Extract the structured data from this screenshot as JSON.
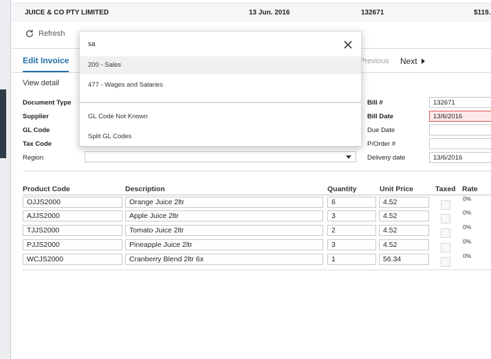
{
  "list": {
    "row": {
      "supplier": "JUICE & CO PTY LIMITED",
      "date": "13 Jun. 2016",
      "bill_number": "132671",
      "amount": "$119."
    }
  },
  "toolbar": {
    "refresh_label": "Refresh"
  },
  "tabs": {
    "active_label": "Edit Invoice",
    "previous_label": "Previous",
    "next_label": "Next"
  },
  "view_detail_label": "View detail",
  "form": {
    "document_type_label": "Document Type",
    "supplier_label": "Supplier",
    "gl_code_label": "GL Code",
    "tax_code_label": "Tax Code",
    "region_label": "Region",
    "bill_number_label": "Bill #",
    "bill_number_value": "132671",
    "bill_date_label": "Bill Date",
    "bill_date_value": "13/6/2016",
    "due_date_label": "Due Date",
    "po_label": "P/Order #",
    "delivery_date_label": "Delivery date",
    "delivery_date_value": "13/6/2016"
  },
  "table": {
    "headers": {
      "product_code": "Product Code",
      "description": "Description",
      "quantity": "Quantity",
      "unit_price": "Unit Price",
      "taxed": "Taxed",
      "rate": "Rate"
    },
    "rows": [
      {
        "code": "OJJS2000",
        "description": "Orange Juice 2ltr",
        "quantity": "6",
        "unit_price": "4.52",
        "taxed": false,
        "rate": "0%"
      },
      {
        "code": "AJJS2000",
        "description": "Apple Juice 2ltr",
        "quantity": "3",
        "unit_price": "4.52",
        "taxed": false,
        "rate": "0%"
      },
      {
        "code": "TJJS2000",
        "description": "Tomato Juice 2ltr",
        "quantity": "2",
        "unit_price": "4.52",
        "taxed": false,
        "rate": "0%"
      },
      {
        "code": "PJJS2000",
        "description": "Pineapple Juice 2ltr",
        "quantity": "3",
        "unit_price": "4.52",
        "taxed": false,
        "rate": "0%"
      },
      {
        "code": "WCJS2000",
        "description": "Cranberry Blend 2ltr 6x",
        "quantity": "1",
        "unit_price": "56.34",
        "taxed": false,
        "rate": "0%"
      }
    ]
  },
  "dropdown": {
    "search_value": "sa",
    "options": [
      {
        "label": "200 - Sales",
        "highlighted": true
      },
      {
        "label": "477 - Wages and Salaries",
        "highlighted": false
      }
    ],
    "extra_options": [
      {
        "label": "GL Code Not Known"
      },
      {
        "label": "Split GL Codes"
      }
    ]
  }
}
